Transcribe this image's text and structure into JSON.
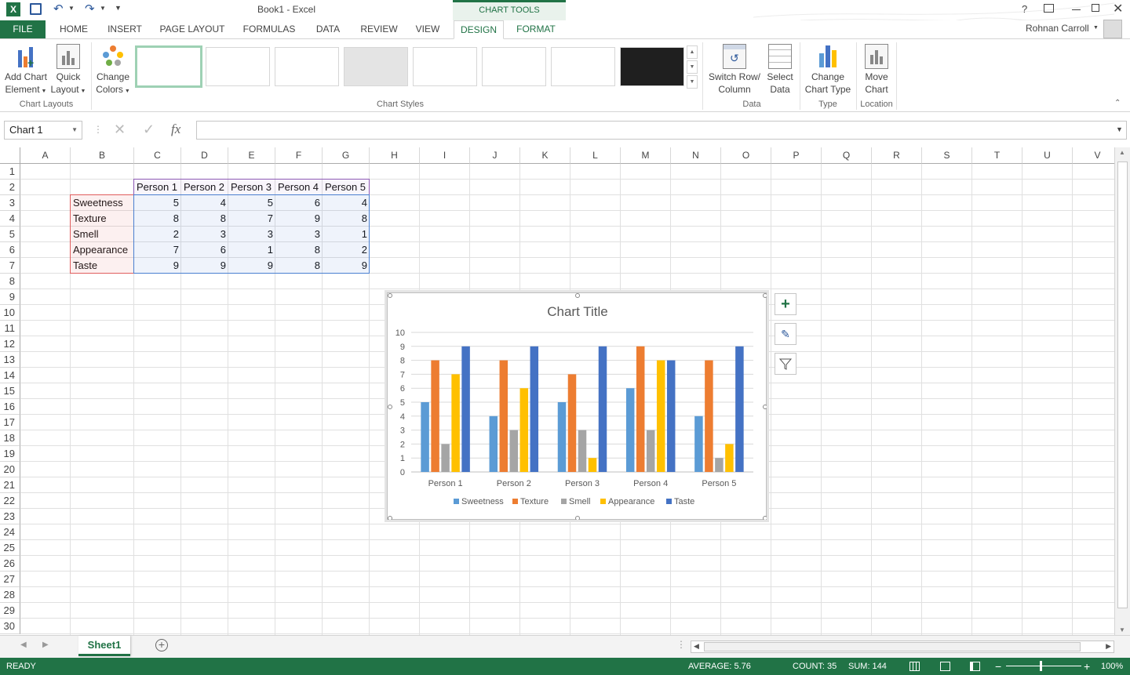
{
  "window": {
    "title": "Book1 - Excel",
    "context_tab_group": "CHART TOOLS",
    "user": "Rohnan Carroll",
    "controls": [
      "?",
      "restore-ribbon",
      "minimize",
      "maximize",
      "close"
    ]
  },
  "tabs": [
    {
      "label": "FILE"
    },
    {
      "label": "HOME"
    },
    {
      "label": "INSERT"
    },
    {
      "label": "PAGE LAYOUT"
    },
    {
      "label": "FORMULAS"
    },
    {
      "label": "DATA"
    },
    {
      "label": "REVIEW"
    },
    {
      "label": "VIEW"
    },
    {
      "label": "DESIGN"
    },
    {
      "label": "FORMAT"
    }
  ],
  "ribbon": {
    "add_chart_element": [
      "Add Chart",
      "Element"
    ],
    "quick_layout": [
      "Quick",
      "Layout"
    ],
    "change_colors": [
      "Change",
      "Colors"
    ],
    "group_chart_layouts": "Chart Layouts",
    "group_chart_styles": "Chart Styles",
    "switch_row_column": [
      "Switch Row/",
      "Column"
    ],
    "select_data": [
      "Select",
      "Data"
    ],
    "group_data": "Data",
    "change_chart_type": [
      "Change",
      "Chart Type"
    ],
    "group_type": "Type",
    "move_chart": [
      "Move",
      "Chart"
    ],
    "group_location": "Location"
  },
  "formula_bar": {
    "name_box": "Chart 1",
    "fx": "fx",
    "value": ""
  },
  "columns": [
    "A",
    "B",
    "C",
    "D",
    "E",
    "F",
    "G",
    "H",
    "I",
    "J",
    "K",
    "L",
    "M",
    "N",
    "O",
    "P",
    "Q",
    "R",
    "S",
    "T",
    "U",
    "V"
  ],
  "rows": [
    1,
    2,
    3,
    4,
    5,
    6,
    7,
    8,
    9,
    10,
    11,
    12,
    13,
    14,
    15,
    16,
    17,
    18,
    19,
    20,
    21,
    22,
    23,
    24,
    25,
    26,
    27,
    28,
    29,
    30
  ],
  "sheet": {
    "headers": [
      "Person 1",
      "Person 2",
      "Person 3",
      "Person 4",
      "Person 5"
    ],
    "row_labels": [
      "Sweetness",
      "Texture",
      "Smell",
      "Appearance",
      "Taste"
    ],
    "values": [
      [
        5,
        4,
        5,
        6,
        4
      ],
      [
        8,
        8,
        7,
        9,
        8
      ],
      [
        2,
        3,
        3,
        3,
        1
      ],
      [
        7,
        6,
        1,
        8,
        2
      ],
      [
        9,
        9,
        9,
        8,
        9
      ]
    ]
  },
  "chart_data": {
    "type": "bar",
    "title": "Chart Title",
    "categories": [
      "Person 1",
      "Person 2",
      "Person 3",
      "Person 4",
      "Person 5"
    ],
    "series": [
      {
        "name": "Sweetness",
        "color": "#5b9bd5",
        "values": [
          5,
          4,
          5,
          6,
          4
        ]
      },
      {
        "name": "Texture",
        "color": "#ed7d31",
        "values": [
          8,
          8,
          7,
          9,
          8
        ]
      },
      {
        "name": "Smell",
        "color": "#a5a5a5",
        "values": [
          2,
          3,
          3,
          3,
          1
        ]
      },
      {
        "name": "Appearance",
        "color": "#ffc000",
        "values": [
          7,
          6,
          1,
          8,
          2
        ]
      },
      {
        "name": "Taste",
        "color": "#4472c4",
        "values": [
          9,
          9,
          9,
          8,
          9
        ]
      }
    ],
    "ylim": [
      0,
      10
    ],
    "yticks": [
      0,
      1,
      2,
      3,
      4,
      5,
      6,
      7,
      8,
      9,
      10
    ],
    "grid": true,
    "legend": "bottom"
  },
  "sheet_tabs": {
    "active": "Sheet1"
  },
  "status": {
    "mode": "READY",
    "average": "AVERAGE: 5.76",
    "count": "COUNT: 35",
    "sum": "SUM: 144",
    "zoom": "100%"
  },
  "colors": {
    "excel_green": "#217346",
    "design_tab": "#217346"
  }
}
